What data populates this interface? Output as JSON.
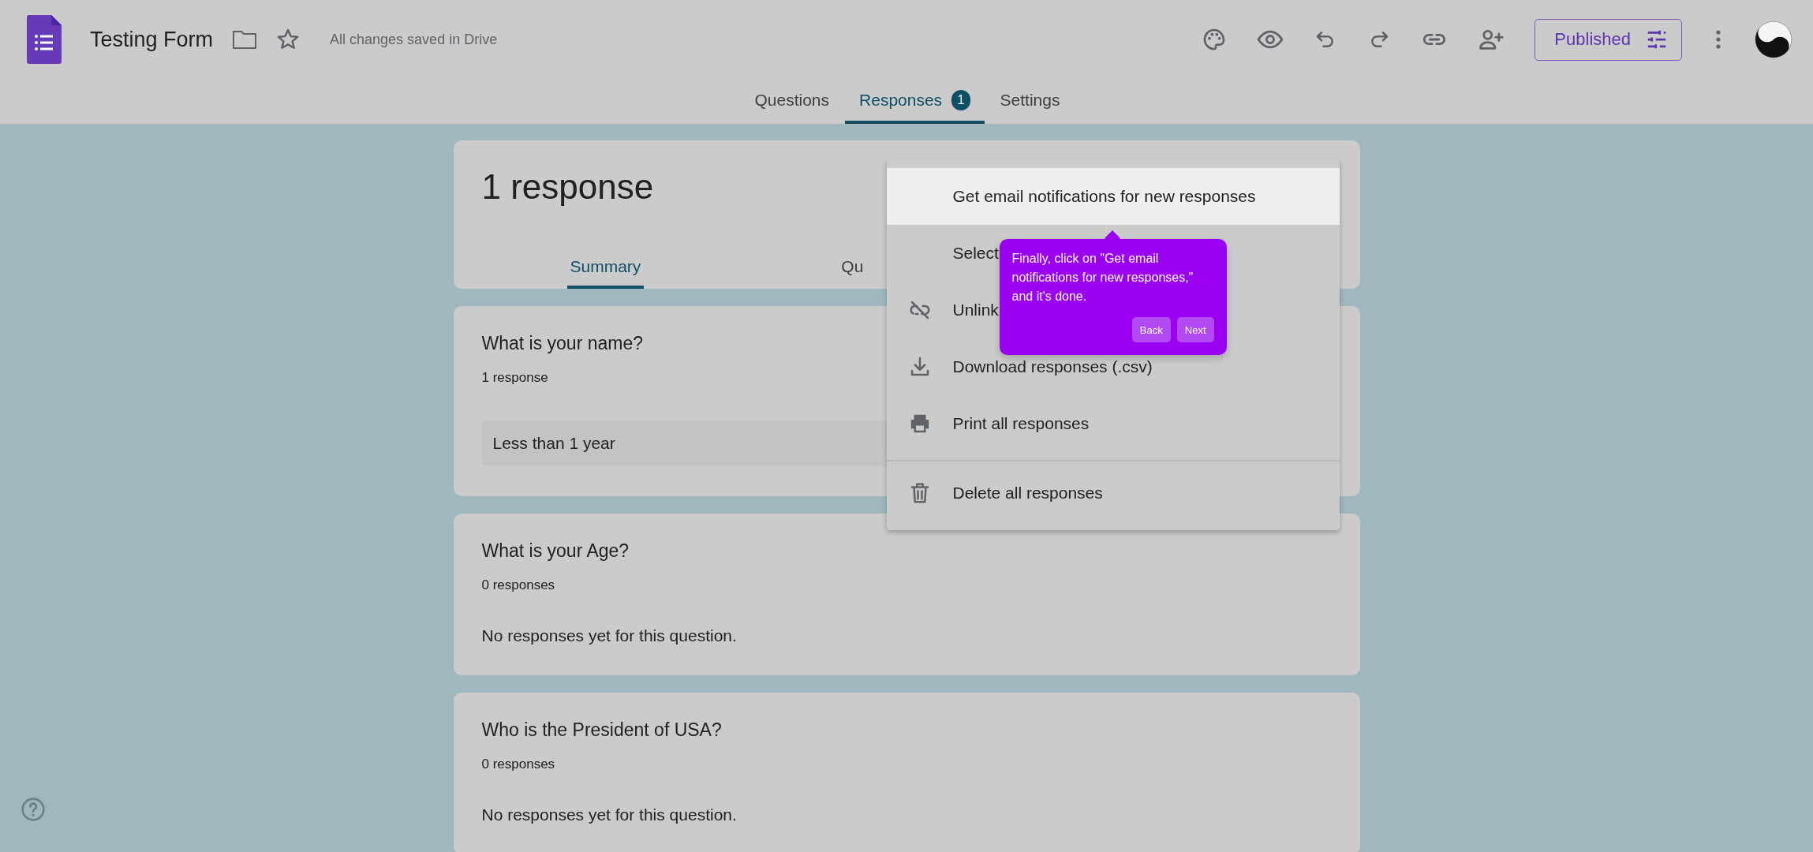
{
  "header": {
    "app_title": "Testing Form",
    "save_status": "All changes saved in Drive",
    "publish_button": "Published"
  },
  "tabs": [
    {
      "label": "Questions",
      "selected": false
    },
    {
      "label": "Responses",
      "selected": true,
      "badge": "1"
    },
    {
      "label": "Settings",
      "selected": false
    }
  ],
  "summary_card": {
    "title": "1 response",
    "tabs": [
      {
        "label": "Summary",
        "selected": true
      },
      {
        "label": "Qu",
        "selected": false
      }
    ]
  },
  "questions": [
    {
      "title": "What is your name?",
      "count": "1 response",
      "answers": [
        "Less than 1 year"
      ]
    },
    {
      "title": "What is your Age?",
      "count": "0 responses",
      "empty_message": "No responses yet for this question."
    },
    {
      "title": "Who is the President of USA?",
      "count": "0 responses",
      "empty_message": "No responses yet for this question."
    }
  ],
  "menu": {
    "items": [
      {
        "label": "Get email notifications for new responses",
        "kind": "plain",
        "highlighted": true,
        "divider_before": false
      },
      {
        "label": "Select",
        "kind": "plain",
        "highlighted": false,
        "divider_before": false
      },
      {
        "label": "Unlink",
        "kind": "unlink",
        "highlighted": false,
        "divider_before": false
      },
      {
        "label": "Download responses (.csv)",
        "kind": "download",
        "highlighted": false,
        "divider_before": false
      },
      {
        "label": "Print all responses",
        "kind": "print",
        "highlighted": false,
        "divider_before": false
      },
      {
        "label": "Delete all responses",
        "kind": "delete",
        "highlighted": false,
        "divider_before": true
      }
    ]
  },
  "tooltip": {
    "text": "Finally, click on \"Get email notifications for new responses,\" and it's done.",
    "buttons": [
      "Back",
      "Next"
    ]
  }
}
